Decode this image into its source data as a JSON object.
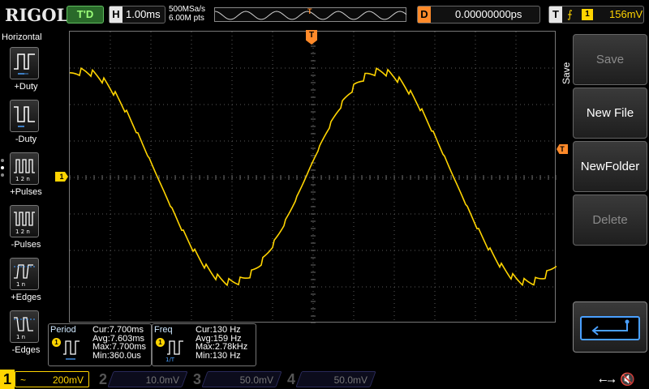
{
  "header": {
    "logo": "RIGOL",
    "run_status": "T'D",
    "horizontal": {
      "label": "H",
      "timebase": "1.00ms"
    },
    "sample_rate": "500MSa/s",
    "memory_depth": "6.00M pts",
    "trigger_position_mark": "T",
    "delay": {
      "label": "D",
      "value": "0.00000000ps"
    },
    "trigger": {
      "label": "T",
      "edge_icon": "rising-edge-icon",
      "source": "1",
      "level": "156mV"
    }
  },
  "left_menu": {
    "title": "Horizontal",
    "items": [
      {
        "label": "+Duty",
        "icon": "positive-duty-icon"
      },
      {
        "label": "-Duty",
        "icon": "negative-duty-icon"
      },
      {
        "label": "+Pulses",
        "icon": "positive-pulses-icon"
      },
      {
        "label": "-Pulses",
        "icon": "negative-pulses-icon"
      },
      {
        "label": "+Edges",
        "icon": "rising-edges-icon"
      },
      {
        "label": "-Edges",
        "icon": "falling-edges-icon"
      }
    ]
  },
  "markers": {
    "channel1": "1",
    "trigger_top": "T",
    "trigger_level": "T"
  },
  "right_menu": {
    "title": "Save",
    "buttons": [
      {
        "label": "Save",
        "enabled": false
      },
      {
        "label": "New File",
        "enabled": true
      },
      {
        "label": "NewFolder",
        "enabled": true
      },
      {
        "label": "Delete",
        "enabled": false
      }
    ],
    "enter_icon": "enter-arrow-icon"
  },
  "measurements": [
    {
      "name": "Period",
      "source": "1",
      "cur": "Cur:7.700ms",
      "avg": "Avg:7.603ms",
      "max": "Max:7.700ms",
      "min": "Min:360.0us"
    },
    {
      "name": "Freq",
      "source": "1",
      "cur": "Cur:130 Hz",
      "avg": "Avg:159 Hz",
      "max": "Max:2.78kHz",
      "min": "Min:130 Hz"
    }
  ],
  "channels": [
    {
      "num": "1",
      "coupling": "~",
      "scale": "200mV",
      "active": true
    },
    {
      "num": "2",
      "coupling": "",
      "scale": "10.0mV",
      "active": false
    },
    {
      "num": "3",
      "coupling": "",
      "scale": "50.0mV",
      "active": false
    },
    {
      "num": "4",
      "coupling": "",
      "scale": "50.0mV",
      "active": false
    }
  ],
  "status_icons": [
    "usb-icon",
    "sound-muted-icon"
  ],
  "colors": {
    "channel1": "#ffd400",
    "trigger": "#ff8a2a",
    "grid": "#777777",
    "enter_accent": "#4aa0ff"
  }
}
